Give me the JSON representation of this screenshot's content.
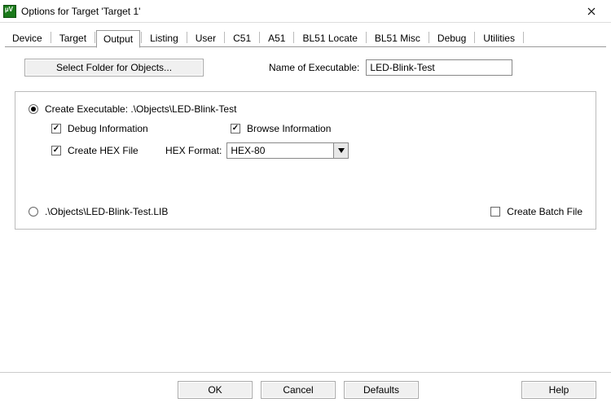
{
  "window": {
    "title": "Options for Target 'Target 1'"
  },
  "tabs": {
    "device": "Device",
    "target": "Target",
    "output": "Output",
    "listing": "Listing",
    "user": "User",
    "c51": "C51",
    "a51": "A51",
    "bl51_locate": "BL51 Locate",
    "bl51_misc": "BL51 Misc",
    "debug": "Debug",
    "utilities": "Utilities"
  },
  "toolbar": {
    "select_folder": "Select Folder for Objects...",
    "name_exec_label": "Name of Executable:",
    "name_exec_value": "LED-Blink-Test"
  },
  "group": {
    "create_exec_label": "Create Executable:  .\\Objects\\LED-Blink-Test",
    "debug_info": "Debug Information",
    "browse_info": "Browse Information",
    "create_hex": "Create HEX File",
    "hex_format_label": "HEX Format:",
    "hex_format_value": "HEX-80",
    "create_lib_label": ".\\Objects\\LED-Blink-Test.LIB",
    "create_batch": "Create Batch File"
  },
  "buttons": {
    "ok": "OK",
    "cancel": "Cancel",
    "defaults": "Defaults",
    "help": "Help"
  }
}
